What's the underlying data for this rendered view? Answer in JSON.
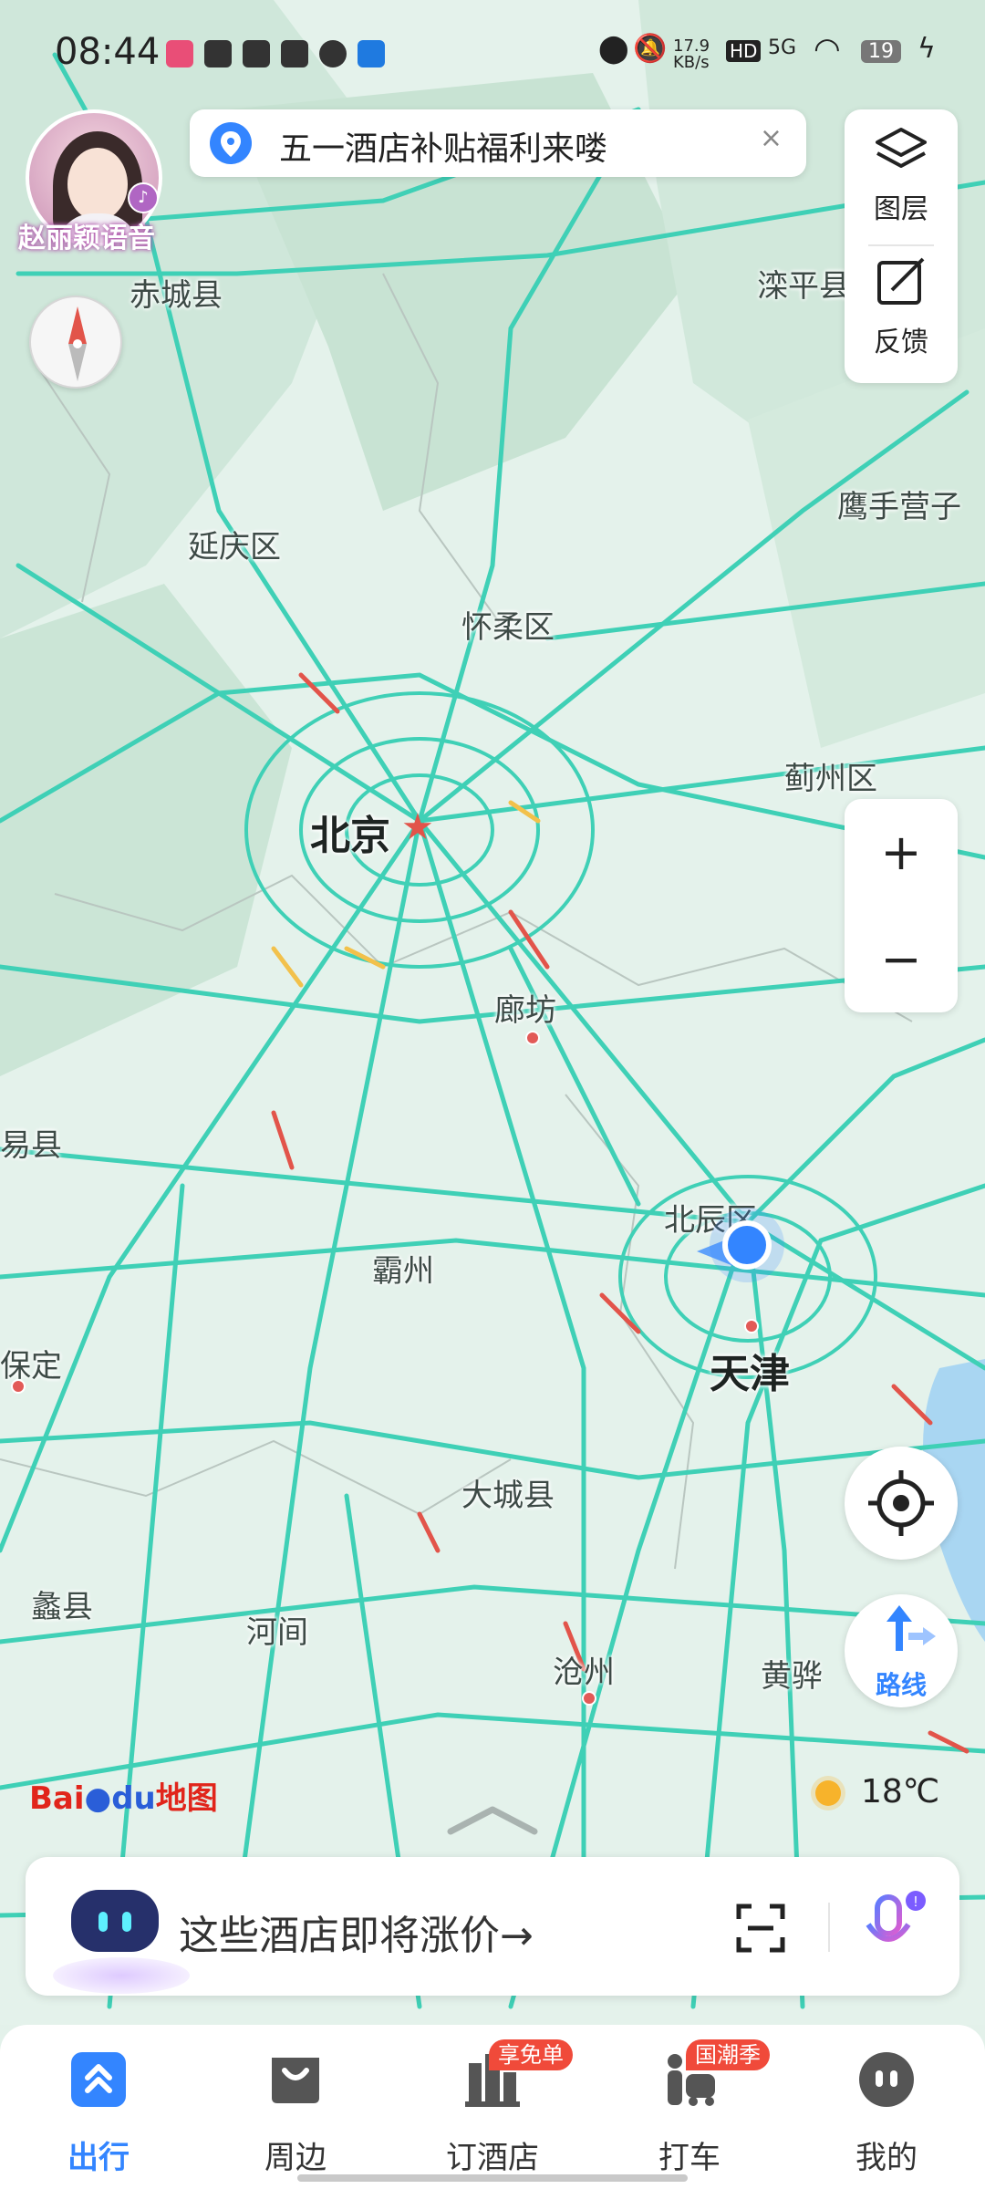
{
  "status_bar": {
    "time": "08:44",
    "network_speed": "17.9 KB/s",
    "hd": "HD",
    "signal": "5G",
    "battery": "19"
  },
  "promo": {
    "text": "五一酒店补贴福利来喽",
    "close": "×"
  },
  "avatar": {
    "label": "赵丽颖语音"
  },
  "tools": {
    "layers_label": "图层",
    "feedback_label": "反馈"
  },
  "zoom": {
    "plus": "+",
    "minus": "−"
  },
  "route": {
    "label": "路线"
  },
  "map": {
    "labels": [
      "赤城县",
      "滦平县",
      "鹰手营子",
      "延庆区",
      "怀柔区",
      "蓟州区",
      "北京",
      "廊坊",
      "易县",
      "北辰区",
      "霸州",
      "天津",
      "保定",
      "大城县",
      "蠡县",
      "河间",
      "沧州",
      "黄骅"
    ],
    "accent_color": "#3385ff",
    "road_color": "#3fd0b6",
    "congestion_color": "#e2544a"
  },
  "logo": {
    "text_bai": "Bai",
    "text_du": "du",
    "text_ditu": "地图"
  },
  "weather": {
    "temp": "18℃",
    "icon": "sun-icon"
  },
  "search": {
    "prompt": "这些酒店即将涨价→"
  },
  "nav": {
    "items": [
      {
        "label": "出行",
        "icon": "travel-icon",
        "active": true
      },
      {
        "label": "周边",
        "icon": "nearby-icon"
      },
      {
        "label": "订酒店",
        "icon": "hotel-icon",
        "badge": "享免单"
      },
      {
        "label": "打车",
        "icon": "taxi-icon",
        "badge": "国潮季"
      },
      {
        "label": "我的",
        "icon": "profile-icon"
      }
    ]
  }
}
